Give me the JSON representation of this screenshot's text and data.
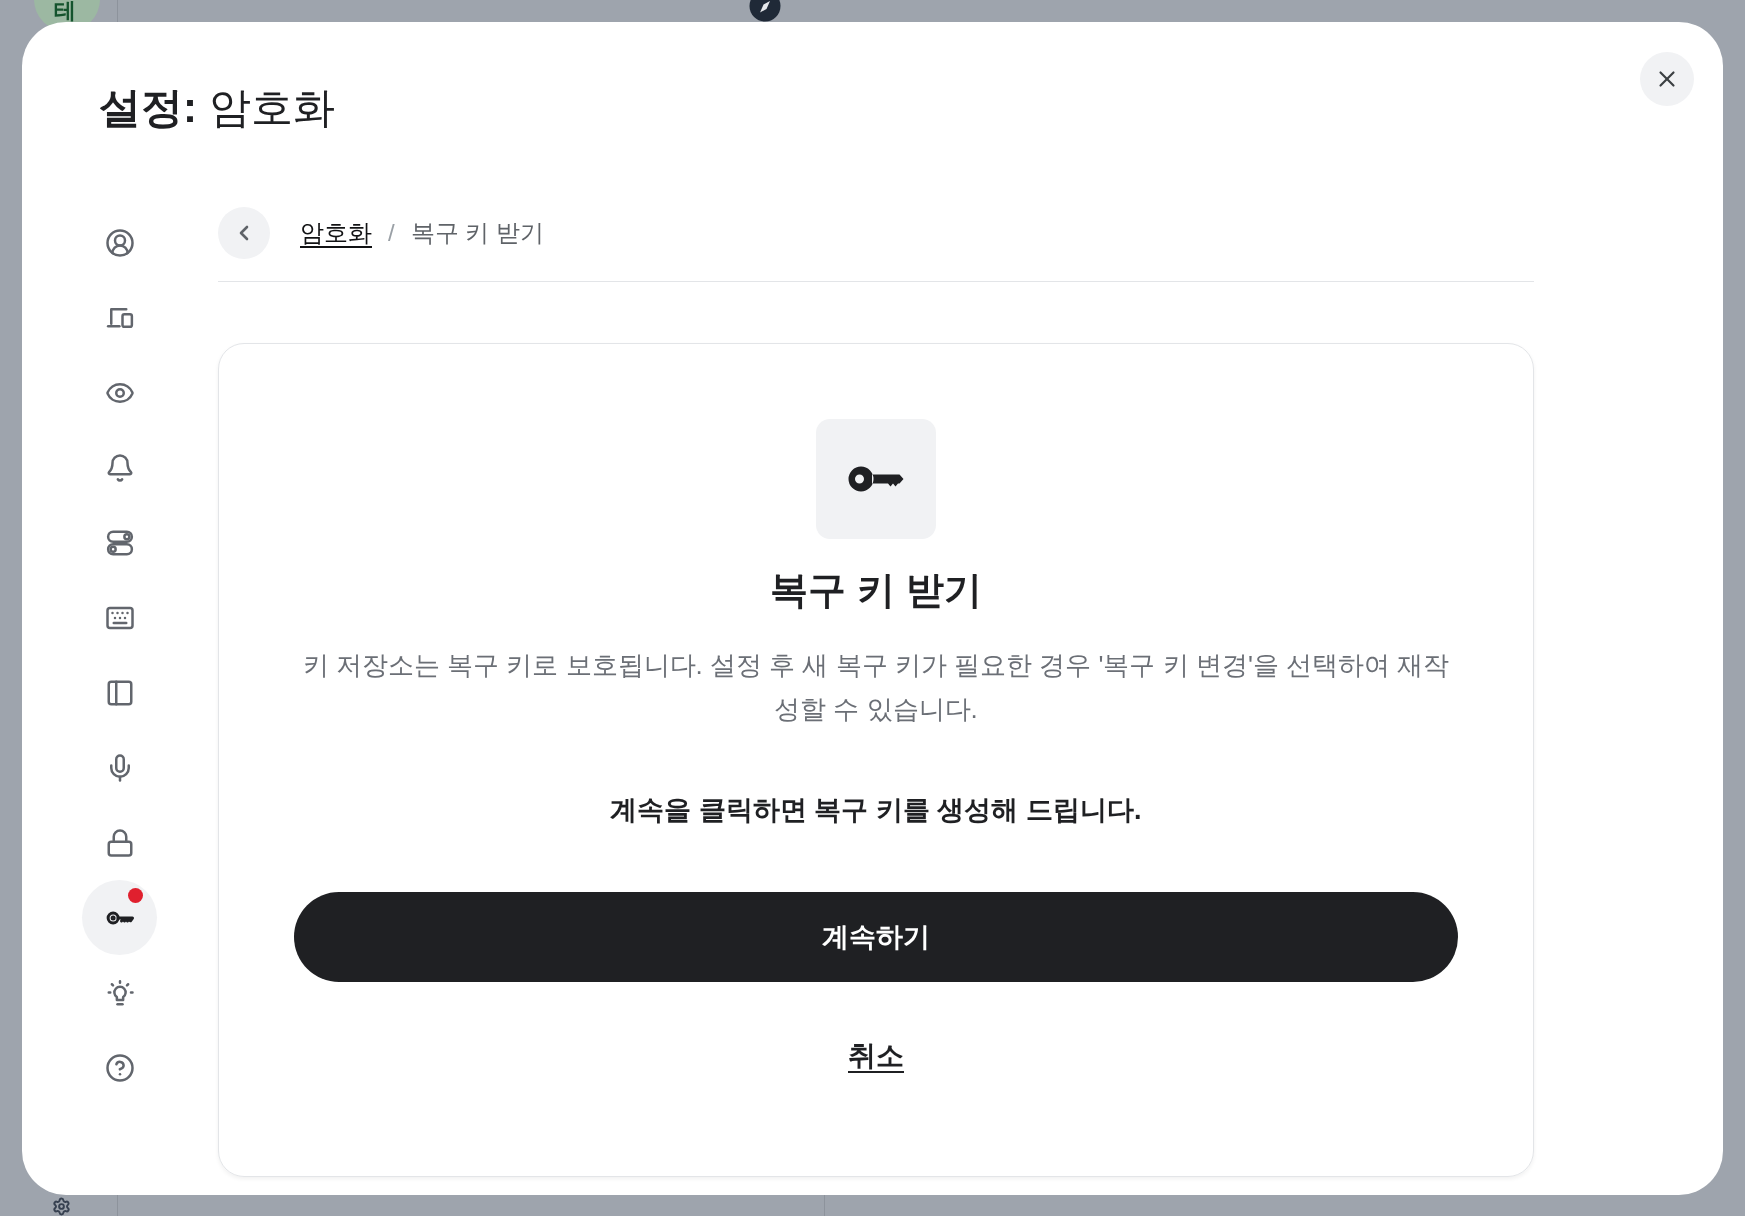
{
  "backdrop": {
    "avatar_letter": "테"
  },
  "dialog": {
    "title": "**설정:** 암호화"
  },
  "sidebar": {
    "items": [
      {
        "selected": false,
        "alert": false
      },
      {
        "selected": false,
        "alert": false
      },
      {
        "selected": false,
        "alert": false
      },
      {
        "selected": false,
        "alert": false
      },
      {
        "selected": false,
        "alert": false
      },
      {
        "selected": false,
        "alert": false
      },
      {
        "selected": false,
        "alert": false
      },
      {
        "selected": false,
        "alert": false
      },
      {
        "selected": false,
        "alert": false
      },
      {
        "selected": true,
        "alert": true
      },
      {
        "selected": false,
        "alert": false
      },
      {
        "selected": false,
        "alert": false
      }
    ]
  },
  "breadcrumb": {
    "items": [
      {
        "label": "암호화",
        "kind": "link"
      },
      {
        "label": "복구 키 받기",
        "kind": "current"
      }
    ],
    "separator": "/"
  },
  "panel": {
    "heading": "복구 키 받기",
    "description": "키 저장소는 복구 키로 보호됩니다. 설정 후 새 복구 키가 필요한 경우 '복구 키 변경'을 선택하여 재작성할 수 있습니다.",
    "instruction": "계속을 클릭하면 복구 키를 생성해 드립니다.",
    "primary_button": "계속하기",
    "cancel_link": "취소"
  }
}
